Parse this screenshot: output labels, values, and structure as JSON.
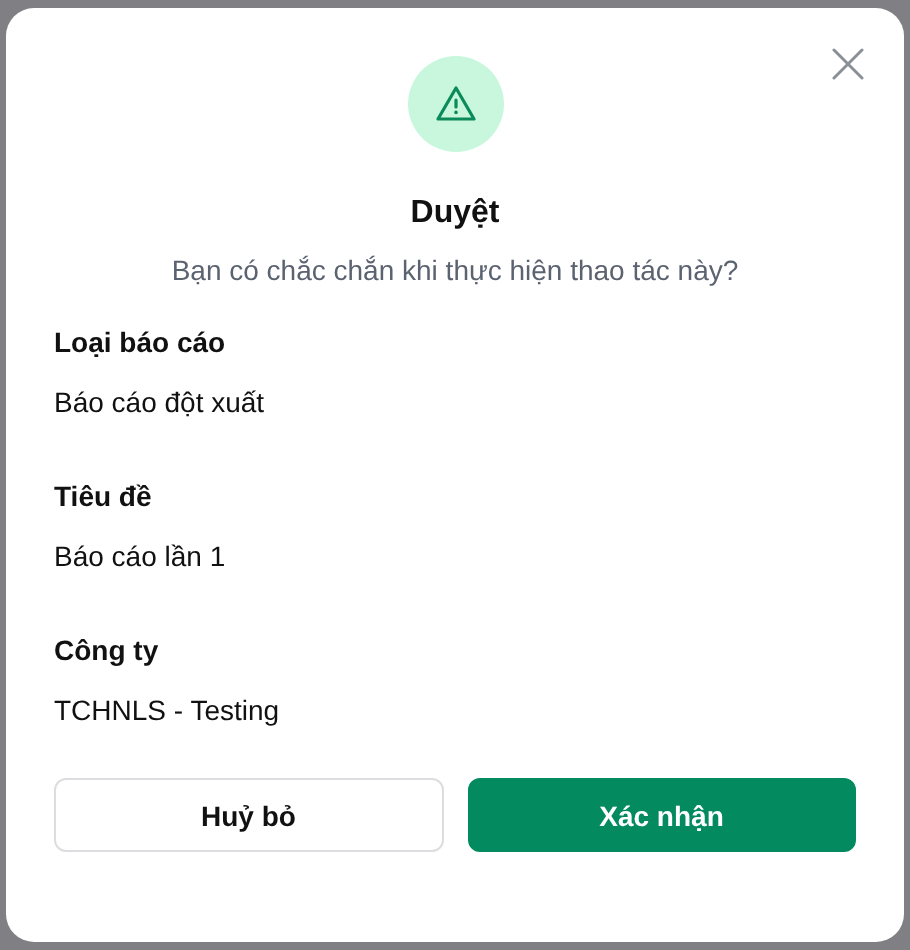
{
  "dialog": {
    "title": "Duyệt",
    "message": "Bạn có chắc chắn khi thực hiện thao tác này?",
    "fields": [
      {
        "label": "Loại báo cáo",
        "value": "Báo cáo đột xuất"
      },
      {
        "label": "Tiêu đề",
        "value": "Báo cáo lần 1"
      },
      {
        "label": "Công ty",
        "value": "TCHNLS - Testing"
      }
    ],
    "buttons": [
      {
        "label": "Huỷ bỏ",
        "kind": "secondary"
      },
      {
        "label": "Xác nhận",
        "kind": "primary"
      }
    ]
  }
}
